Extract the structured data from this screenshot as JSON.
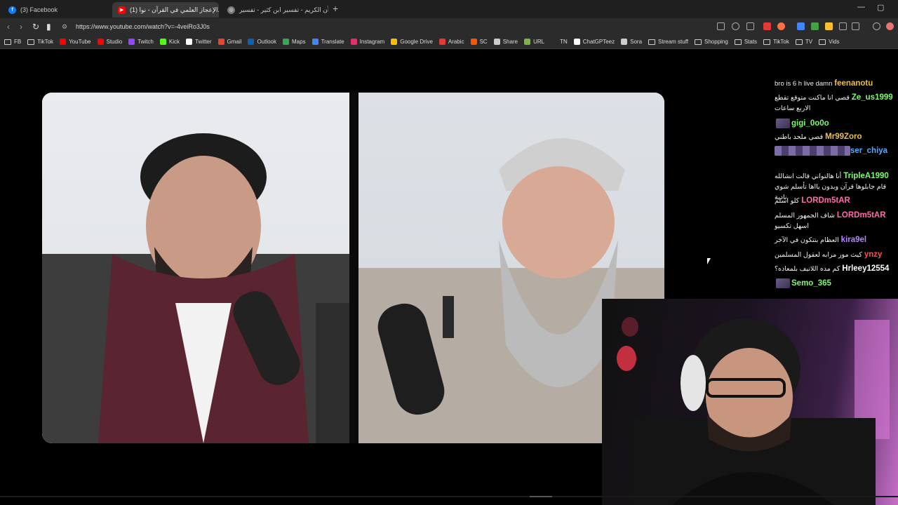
{
  "browser": {
    "tabs": [
      {
        "label": "(3) Facebook",
        "favicon": "facebook-icon",
        "color": "#1877f2",
        "active": false
      },
      {
        "label": "(1) الإعجاز العلمي في القرآن - نوا...",
        "favicon": "youtube-icon",
        "color": "#ff0000",
        "active": true
      },
      {
        "label": "القرآن الكريم - تفسير ابن كثير - تفسير ...",
        "favicon": "globe-icon",
        "color": "#777777",
        "active": false
      }
    ],
    "new_tab_label": "+",
    "minimize": "—",
    "maximize": "▢",
    "url": "https://www.youtube.com/watch?v=-4veiRo3J0s"
  },
  "bookmarks": [
    {
      "label": "FB",
      "icon": "folder-icon"
    },
    {
      "label": "TikTok",
      "icon": "folder-icon"
    },
    {
      "label": "YouTube",
      "icon": "youtube-icon",
      "color": "#ff0000"
    },
    {
      "label": "Studio",
      "icon": "youtube-studio-icon",
      "color": "#ff0000"
    },
    {
      "label": "Twitch",
      "icon": "twitch-icon",
      "color": "#9146ff"
    },
    {
      "label": "Kick",
      "icon": "kick-icon",
      "color": "#53fc18"
    },
    {
      "label": "Twitter",
      "icon": "x-icon",
      "color": "#ffffff"
    },
    {
      "label": "Gmail",
      "icon": "gmail-icon",
      "color": "#ea4335"
    },
    {
      "label": "Outlook",
      "icon": "outlook-icon",
      "color": "#0a64ad"
    },
    {
      "label": "Maps",
      "icon": "maps-icon",
      "color": "#34a853"
    },
    {
      "label": "Translate",
      "icon": "translate-icon",
      "color": "#4285f4"
    },
    {
      "label": "Instagram",
      "icon": "instagram-icon",
      "color": "#e1306c"
    },
    {
      "label": "Google Drive",
      "icon": "drive-icon",
      "color": "#fbbc04"
    },
    {
      "label": "Arabic",
      "icon": "arabic-icon",
      "color": "#e53935"
    },
    {
      "label": "SC",
      "icon": "sc-icon",
      "color": "#ff5500"
    },
    {
      "label": "Share",
      "icon": "cloud-icon",
      "color": "#cccccc"
    },
    {
      "label": "URL",
      "icon": "url-icon",
      "color": "#7cb342"
    },
    {
      "label": "TN",
      "icon": "none",
      "color": "#2b2b2b"
    },
    {
      "label": "ChatGPTeez",
      "icon": "chatgpt-icon",
      "color": "#ffffff"
    },
    {
      "label": "Sora",
      "icon": "sora-icon",
      "color": "#cccccc"
    },
    {
      "label": "Stream stuff",
      "icon": "folder-icon"
    },
    {
      "label": "Shopping",
      "icon": "folder-icon"
    },
    {
      "label": "Stats",
      "icon": "folder-icon"
    },
    {
      "label": "TikTok",
      "icon": "folder-icon"
    },
    {
      "label": "TV",
      "icon": "folder-icon"
    },
    {
      "label": "Vids",
      "icon": "folder-icon"
    }
  ],
  "chat": [
    {
      "user": "feenanotu",
      "text": "bro is 6 h live damn",
      "color": "#e8c04b"
    },
    {
      "user": "Ze_us1999",
      "text": "قصي انا ماكنت متوقع تقطع الاربع ساعات",
      "color": "#7cfc6a"
    },
    {
      "user": "gigi_0o0o",
      "text": "",
      "color": "#7cfc6a",
      "emote": true
    },
    {
      "user": "Mr99Zoro",
      "text": "قصي ملحد باطني",
      "color": "#e8c04b"
    },
    {
      "user": "ser_chiya",
      "text": "",
      "color": "#5aa9ff",
      "emote_row": true
    },
    {
      "user": "TripleA1990",
      "text": "أنا هالتواني قالت انشالله قام جابلوها قرآن وبدون يااها تأسلم شوي نادية",
      "color": "#7cfc6a"
    },
    {
      "user": "LORDm5tAR",
      "text": "كلو اسلم",
      "color": "#ff6aa8"
    },
    {
      "user": "LORDm5tAR",
      "text": "شاف الجمهور المسلم اسهل تكسيو",
      "color": "#ff6aa8"
    },
    {
      "user": "kira9el",
      "text": "العظام بتتكون في الآخر",
      "color": "#b983ff"
    },
    {
      "user": "ynzy",
      "text": "كيث مور مرابه لعقول المسلمين",
      "color": "#ff4d4d"
    },
    {
      "user": "Hrleey12554",
      "text": "كم مده اللاتيف بلمعاده؟",
      "color": "#ffffff"
    },
    {
      "user": "Semo_365",
      "text": "",
      "color": "#7cfc6a",
      "emote": true
    }
  ]
}
